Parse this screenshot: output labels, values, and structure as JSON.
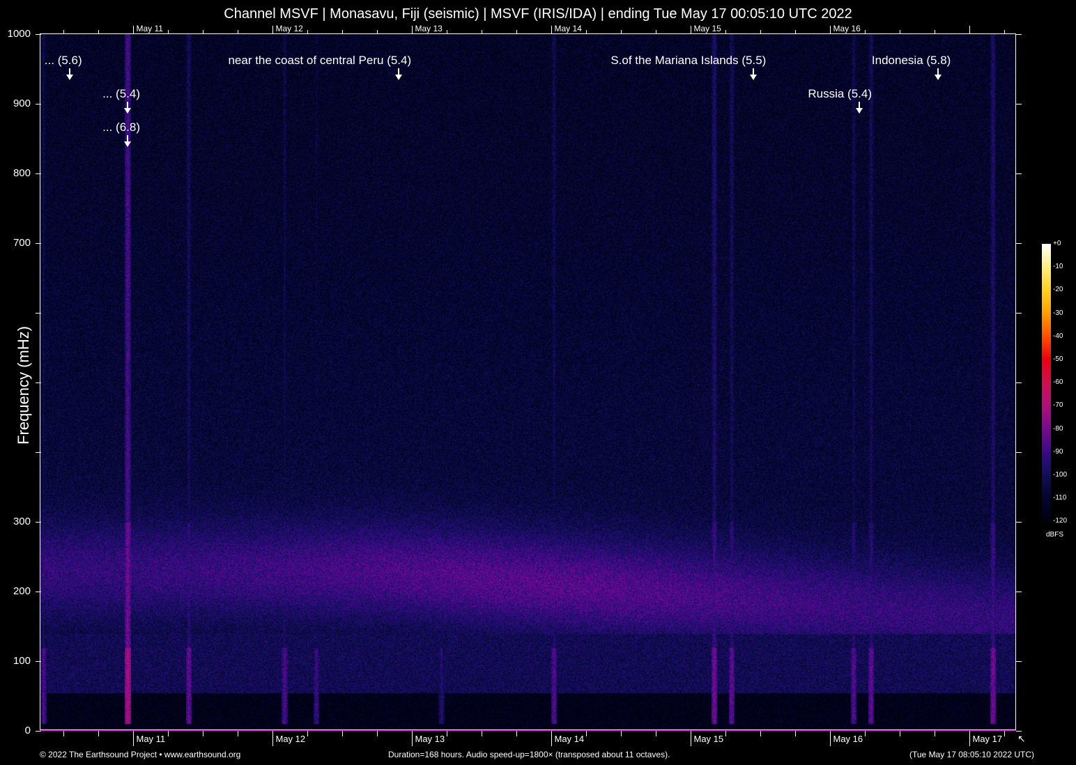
{
  "chart_data": {
    "type": "heatmap",
    "title": "Channel MSVF | Monasavu, Fiji (seismic) | MSVF (IRIS/IDA) | ending Tue May 17 00:05:10 UTC 2022",
    "ylabel": "Frequency (mHz)",
    "ylim": [
      0,
      1000
    ],
    "yticks": [
      0,
      100,
      200,
      300,
      400,
      500,
      600,
      700,
      800,
      900,
      1000
    ],
    "ytick_labels": [
      "0",
      "100",
      "200",
      "300",
      "",
      "",
      "",
      "700",
      "800",
      "900",
      "1000"
    ],
    "xlim_hours": [
      0,
      168
    ],
    "xticks": [
      {
        "label": "May 11",
        "hour": 15.9
      },
      {
        "label": "May 12",
        "hour": 39.9
      },
      {
        "label": "May 13",
        "hour": 63.9
      },
      {
        "label": "May 14",
        "hour": 87.9
      },
      {
        "label": "May 15",
        "hour": 111.9
      },
      {
        "label": "May 16",
        "hour": 135.9
      },
      {
        "label": "May 17",
        "hour": 159.9
      }
    ],
    "top_xticks": [
      "May 11",
      "May 12",
      "May 13",
      "May 14",
      "May 15",
      "May 16"
    ],
    "events": [
      {
        "label": "... (5.6)",
        "hour": 5.0,
        "row": 1
      },
      {
        "label": "... (5.4)",
        "hour": 15.0,
        "row": 2
      },
      {
        "label": "... (6.8)",
        "hour": 15.0,
        "row": 3
      },
      {
        "label": "near the coast of central Peru (5.4)",
        "hour": 61.7,
        "row": 1
      },
      {
        "label": "S.of the Mariana Islands (5.5)",
        "hour": 122.8,
        "row": 1
      },
      {
        "label": "Russia (5.4)",
        "hour": 141.0,
        "row": 2
      },
      {
        "label": "Indonesia (5.8)",
        "hour": 154.6,
        "row": 1
      }
    ],
    "colorbar": {
      "unit": "dBFS",
      "range": [
        -120,
        0
      ],
      "tick_labels": [
        "+0",
        "-10",
        "-20",
        "-30",
        "-40",
        "-50",
        "-60",
        "-70",
        "-80",
        "-90",
        "-100",
        "-110",
        "-120"
      ],
      "colors": [
        "#ffffff",
        "#fff080",
        "#ffd020",
        "#ffa000",
        "#ff5000",
        "#f00010",
        "#d01050",
        "#b0107a",
        "#7a0a90",
        "#3a0a8a",
        "#10105a",
        "#050530",
        "#000010"
      ]
    }
  },
  "footer": {
    "copyright": "© 2022 The Earthsound Project • www.earthsound.org",
    "duration": "Duration=168 hours. Audio speed-up=1800× (transposed about 11 octaves).",
    "local_time": "(Tue May 17 08:05:10 2022 UTC)"
  }
}
